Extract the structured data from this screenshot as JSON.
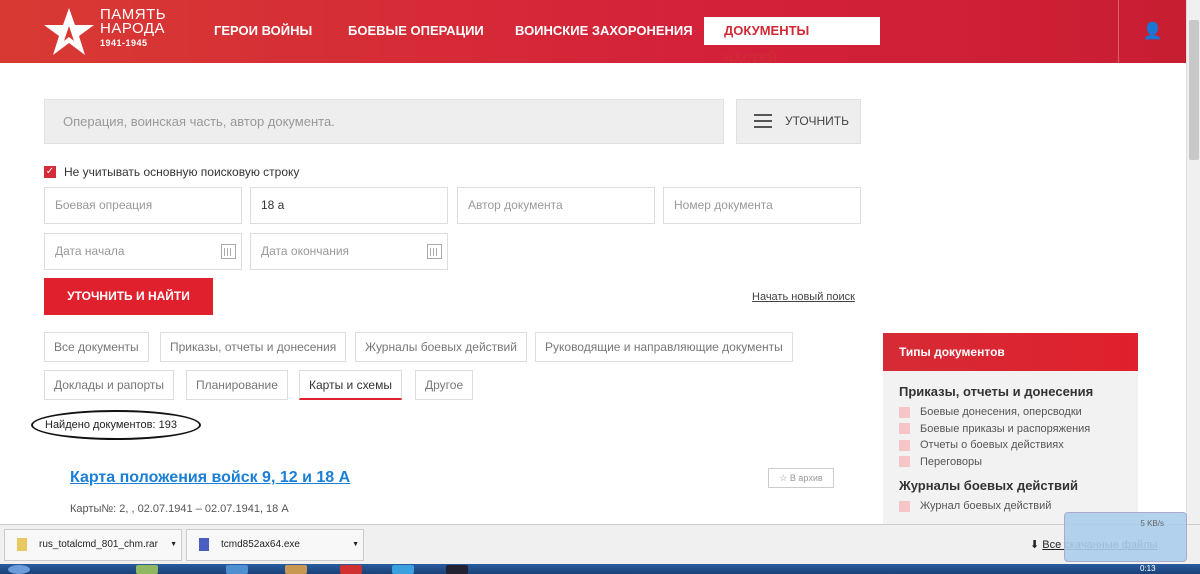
{
  "header": {
    "logo": {
      "line1": "ПАМЯТЬ",
      "line2": "НАРОДА",
      "years": "1941-1945"
    },
    "nav": [
      {
        "label": "ГЕРОИ ВОЙНЫ"
      },
      {
        "label": "БОЕВЫЕ ОПЕРАЦИИ"
      },
      {
        "label": "ВОИНСКИЕ ЗАХОРОНЕНИЯ"
      },
      {
        "label": "ДОКУМЕНТЫ ЧАСТЕЙ",
        "active": true
      }
    ],
    "user_icon": "user-icon"
  },
  "search": {
    "placeholder": "Операция, воинская часть, автор документа.",
    "refine_label": "УТОЧНИТЬ"
  },
  "ignore_main": {
    "label": "Не учитывать основную поисковую строку",
    "checked": true
  },
  "filters": {
    "operation": {
      "placeholder": "Боевая опреация",
      "value": ""
    },
    "unit": {
      "value": "18 а"
    },
    "author": {
      "placeholder": "Автор документа"
    },
    "number": {
      "placeholder": "Номер документа"
    },
    "date_start": {
      "placeholder": "Дата начала"
    },
    "date_end": {
      "placeholder": "Дата окончания"
    }
  },
  "submit_label": "УТОЧНИТЬ И НАЙТИ",
  "new_search": "Начать новый поиск",
  "tabs": [
    {
      "label": "Все документы"
    },
    {
      "label": "Приказы, отчеты и донесения"
    },
    {
      "label": "Журналы боевых действий"
    },
    {
      "label": "Руководящие и направляющие документы"
    },
    {
      "label": "Доклады и рапорты"
    },
    {
      "label": "Планирование"
    },
    {
      "label": "Карты и схемы",
      "active": true
    },
    {
      "label": "Другое"
    }
  ],
  "found": "Найдено документов: 193",
  "result": {
    "title": "Карта положения войск 9, 12 и 18 А",
    "archive": "В архив",
    "meta": "Карты№: 2, , 02.07.1941 – 02.07.1941, 18 А"
  },
  "sidebar": {
    "title": "Типы документов",
    "groups": [
      {
        "title": "Приказы, отчеты и донесения",
        "items": [
          "Боевые донесения, оперсводки",
          "Боевые приказы и распоряжения",
          "Отчеты о боевых действиях",
          "Переговоры"
        ]
      },
      {
        "title": "Журналы боевых действий",
        "items": [
          "Журнал боевых действий"
        ]
      }
    ]
  },
  "downloads": {
    "items": [
      "rus_totalcmd_801_chm.rar",
      "tcmd852ax64.exe"
    ],
    "all": "Все скачанные файлы",
    "speed": "5 KB/s"
  },
  "taskbar": {
    "clock": "0:13"
  },
  "colors": {
    "accent": "#e0202c"
  }
}
